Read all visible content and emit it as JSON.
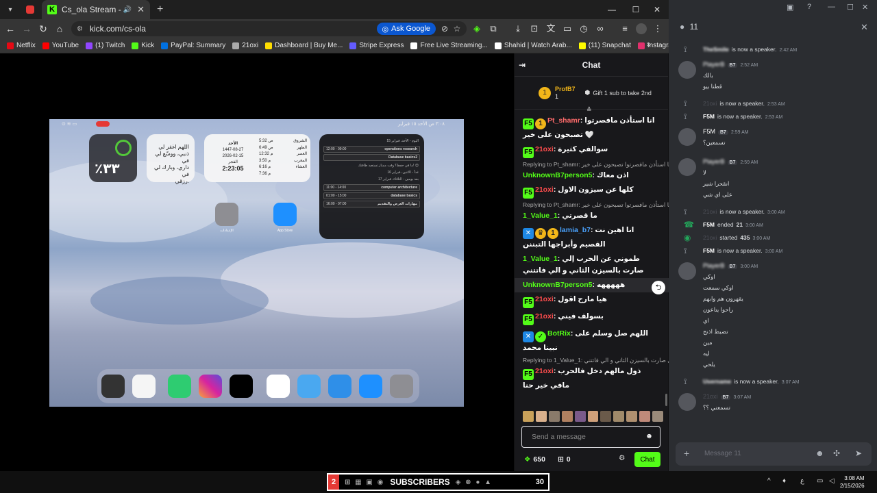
{
  "browser": {
    "active_tab": {
      "title": "Cs_ola Stream - Watch Live"
    },
    "url": "kick.com/cs-ola",
    "ask_google": "Ask Google",
    "bookmarks": [
      "Netflix",
      "YouTube",
      "(1) Twitch",
      "Kick",
      "PayPal: Summary",
      "21oxi",
      "Dashboard | Buy Me...",
      "Stripe Express",
      "Free Live Streaming...",
      "Shahid | Watch Arab...",
      "(11) Snapchat",
      "Instagram"
    ],
    "bookmark_colors": [
      "#e50914",
      "#ff0000",
      "#9146ff",
      "#53fc18",
      "#0070e0",
      "#aaaaaa",
      "#ffdd00",
      "#635bff",
      "#ffffff",
      "#ffffff",
      "#fffc00",
      "#e1306c"
    ]
  },
  "stream": {
    "ipad_status": "٣:٠٨ ص   الأحد ١٥ فبراير",
    "battery_percent": "٪٣٣",
    "prayer_text": [
      "اللهم اغفر لي",
      "ذنبي، ووسّع لي في",
      "داري، وبارك لي في",
      "رزقي."
    ],
    "date_widget": {
      "day": "الأحد",
      "hijri": "1447-08-27",
      "greg": "2026-02-15",
      "prayer_name": "الفجر",
      "countdown": "2:23:05",
      "times": [
        {
          "name": "الشروق",
          "time": "5:32 ص"
        },
        {
          "name": "الظهر",
          "time": "6:49 ص"
        },
        {
          "name": "العصر",
          "time": "12:32 م"
        },
        {
          "name": "المغرب",
          "time": "3:50 م"
        },
        {
          "name": "العشاء",
          "time": "6:16 م"
        },
        {
          "name": "",
          "time": "7:36 م"
        }
      ]
    },
    "schedule": {
      "header": "اليوم - الأحد، فبراير 15",
      "items": [
        {
          "time": "12:00 - 09:00",
          "title": "operations research"
        },
        {
          "time": "",
          "title": "Database basics2"
        },
        {
          "time": "11:00 - 14:00",
          "title": "computer architecture"
        },
        {
          "time": "01:00 - 15:00",
          "title": "database basics"
        },
        {
          "time": "16:00 - 07:00",
          "title": "مهارات العرض والتقديم"
        }
      ],
      "note": "ما في حفظ؟ وقت ممتاز تستعيد طاقتك! 😊",
      "tomorrow": "غداً - الاثنين، فبراير 16",
      "after": "بعد يومين - الثلاثاء، فبراير 17"
    },
    "settings_label": "الإعدادات",
    "appstore_label": "App Store"
  },
  "chat": {
    "title": "Chat",
    "pinned": {
      "user": "ProfB7",
      "count": "1",
      "gift": "Gift 1 sub to take 2nd"
    },
    "messages": [
      {
        "badges": [
          "green",
          "gold"
        ],
        "badge_text": [
          "F5",
          "1"
        ],
        "user": "Pt_shamr",
        "color": "#ff6b6b",
        "text": "انا استأذن مافصرتوا تصبحون على خير 🤍"
      },
      {
        "badges": [
          "green"
        ],
        "badge_text": [
          "F5"
        ],
        "user": "21oxi",
        "color": "#ff4d4d",
        "text": "سوالفي كثيرة"
      },
      {
        "reply": "Replying to Pt_shamr: انا استأذن مافصرتوا تصبحون على خير"
      },
      {
        "badges": [],
        "badge_text": [],
        "user": "UnknownB7person5",
        "color": "#53fc18",
        "text": "اذن معاك"
      },
      {
        "badges": [
          "green"
        ],
        "badge_text": [
          "F5"
        ],
        "user": "21oxi",
        "color": "#ff4d4d",
        "text": "كلها عن سيزون الاول"
      },
      {
        "reply": "Replying to Pt_shamr: انا استأذن مافصرتوا تصبحون على خير"
      },
      {
        "badges": [],
        "badge_text": [],
        "user": "1_Value_1",
        "color": "#53fc18",
        "text": "ما قصرتي"
      },
      {
        "badges": [
          "blue",
          "gold",
          "gold"
        ],
        "badge_text": [
          "✕",
          "♛",
          "1"
        ],
        "user": "lamia_b7",
        "color": "#4aa3ff",
        "text": "انا اهين نت القصيم وأبراجها التبننن"
      },
      {
        "badges": [],
        "badge_text": [],
        "user": "1_Value_1",
        "color": "#53fc18",
        "text": "طموني عن الحرب إلي صارت بالسيزن الثاني و الي فاتتني"
      },
      {
        "badges": [],
        "badge_text": [],
        "user": "UnknownB7person5",
        "color": "#53fc18",
        "text": "هههههه"
      },
      {
        "badges": [
          "green"
        ],
        "badge_text": [
          "F5"
        ],
        "user": "21oxi",
        "color": "#ff4d4d",
        "text": "هيا مارح اقول"
      },
      {
        "badges": [
          "green"
        ],
        "badge_text": [
          "F5"
        ],
        "user": "21oxi",
        "color": "#ff4d4d",
        "text": "بسولف فيني"
      },
      {
        "badges": [
          "blue",
          "verified"
        ],
        "badge_text": [
          "✕",
          "✓"
        ],
        "user": "BotRix",
        "color": "#53fc18",
        "text": "اللهم صل وسلم على نبينا محمد"
      },
      {
        "reply": "Replying to 1_Value_1: طموني عن الحرب إلي صارت بالسيزن الثاني و الي فاتتني"
      },
      {
        "badges": [
          "green"
        ],
        "badge_text": [
          "F5"
        ],
        "user": "21oxi",
        "color": "#ff4d4d",
        "text": "ذول مالهم دخل فالحرب مافي خير حنا"
      }
    ],
    "input_placeholder": "Send a message",
    "points": "650",
    "gifts": "0",
    "send_label": "Chat"
  },
  "discord": {
    "channel_count": "11",
    "events": [
      {
        "type": "speaker",
        "user": "TheSmile",
        "text": "is now a speaker.",
        "time": "2:42 AM"
      },
      {
        "type": "msg",
        "user": "PlayerB",
        "tag": "B7",
        "time": "2:52 AM",
        "lines": [
          "بالك",
          "قطنا بيو"
        ]
      },
      {
        "type": "speaker",
        "user": "21oxi",
        "text": "is now a speaker.",
        "time": "2:53 AM"
      },
      {
        "type": "speaker",
        "user": "F5M",
        "text": "is now a speaker.",
        "time": "2:53 AM"
      },
      {
        "type": "msg",
        "user": "F5M",
        "tag": "B7",
        "time": "2:59 AM",
        "lines": [
          "تسمعين؟"
        ]
      },
      {
        "type": "msg",
        "user": "PlayerB",
        "tag": "B7",
        "time": "2:59 AM",
        "lines": [
          "لا",
          "انقحرا شير",
          "على اي شي"
        ]
      },
      {
        "type": "speaker",
        "user": "21oxi",
        "text": "is now a speaker.",
        "time": "3:00 AM"
      },
      {
        "type": "ended",
        "user": "F5M",
        "text": "ended",
        "num": "21",
        "time": "3:00 AM"
      },
      {
        "type": "started",
        "user": "21oxi",
        "text": "started",
        "num": "435",
        "time": "3:00 AM"
      },
      {
        "type": "speaker",
        "user": "F5M",
        "text": "is now a speaker.",
        "time": "3:00 AM"
      },
      {
        "type": "msg",
        "user": "PlayerB",
        "tag": "B7",
        "time": "3:00 AM",
        "lines": [
          "اوكي",
          "اوكي سمعت",
          "يقهرون هم وابهم",
          "راحوا يتاعون",
          "اي",
          "تضبط اذنح",
          "مين",
          "ليه",
          "يلحي"
        ]
      },
      {
        "type": "speaker",
        "user": "Username",
        "text": "is now a speaker.",
        "time": "3:07 AM"
      },
      {
        "type": "msg",
        "user": "21oxi",
        "tag": "B7",
        "time": "3:07 AM",
        "lines": [
          "تسمعني ؟؟"
        ]
      }
    ],
    "message_placeholder": "Message 11"
  },
  "taskbar": {
    "sub_count": "2",
    "label": "SUBSCRIBERS",
    "goal": "30",
    "time": "3:08 AM",
    "date": "2/15/2026"
  }
}
